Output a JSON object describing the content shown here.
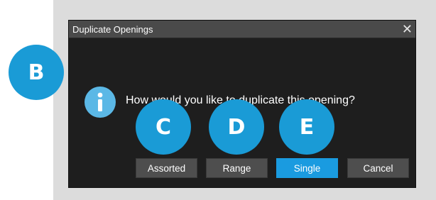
{
  "dialog": {
    "title": "Duplicate Openings",
    "close_symbol": "✕",
    "question": "How would you like to duplicate this opening?",
    "info_icon": "info-icon"
  },
  "buttons": [
    {
      "label": "Assorted",
      "state": "normal"
    },
    {
      "label": "Range",
      "state": "normal"
    },
    {
      "label": "Single",
      "state": "selected"
    },
    {
      "label": "Cancel",
      "state": "normal"
    }
  ],
  "callouts": [
    "B",
    "C",
    "D",
    "E"
  ],
  "colors": {
    "dialog_bg": "#1e1e1e",
    "titlebar_bg": "#4a4a4a",
    "button_bg": "#4e4e4e",
    "primary_button": "#1a9be0",
    "callout_badge": "#1a9bd6",
    "info_icon": "#5bb8e6"
  }
}
